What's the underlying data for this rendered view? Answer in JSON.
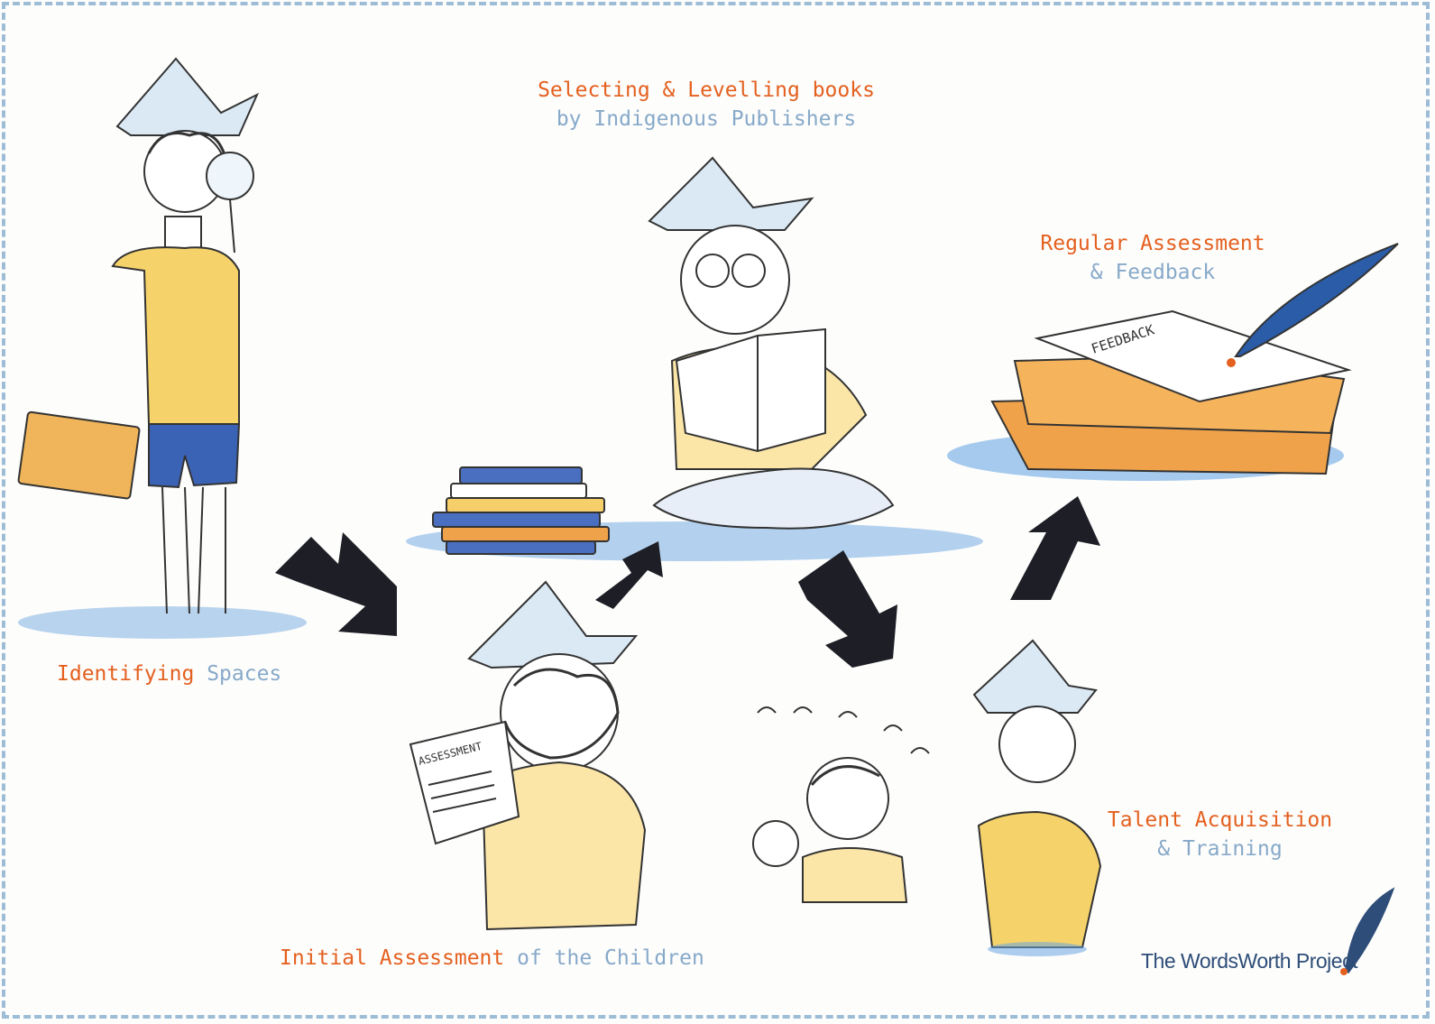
{
  "steps": [
    {
      "id": "identifying",
      "primary": "Identifying",
      "secondary": "Spaces"
    },
    {
      "id": "selecting",
      "line1": "Selecting & Levelling books",
      "line2": "by Indigenous Publishers"
    },
    {
      "id": "regular",
      "line1": "Regular Assessment",
      "line2": "& Feedback"
    },
    {
      "id": "initial",
      "primary": "Initial Assessment",
      "secondary": "of the Children"
    },
    {
      "id": "talent",
      "line1": "Talent Acquisition",
      "line2": "& Training"
    }
  ],
  "illustrations": {
    "assessment_sheet_text": "ASSESSMENT",
    "feedback_book_text": "FEEDBACK"
  },
  "brand": {
    "name": "The WordsWorth Project"
  },
  "colors": {
    "step_primary": "#e4601f",
    "step_secondary": "#87a9c9",
    "border": "#9dbcd6",
    "arrow": "#1e1f26",
    "shirt_yellow": "#f6d36a",
    "shorts_blue": "#3b63b5",
    "book_orange": "#f0a24a",
    "logo": "#2e4d78"
  }
}
